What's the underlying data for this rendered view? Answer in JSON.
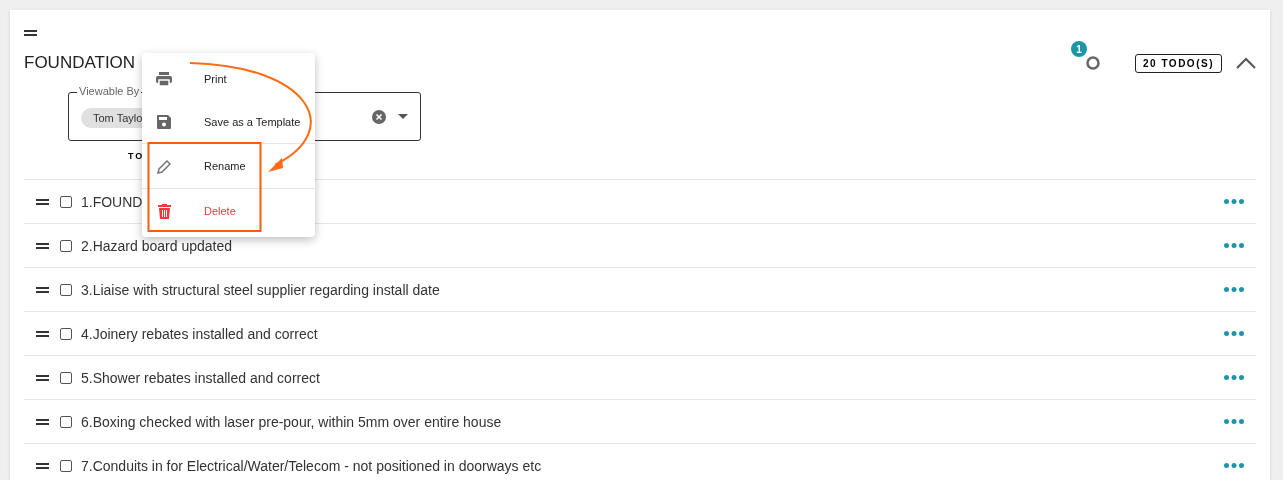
{
  "title": "FOUNDATION",
  "badge": "1",
  "todo_count": "20 TODO(S)",
  "expanded": true,
  "viewable_by": {
    "label": "Viewable By",
    "chips": [
      "Tom Taylo"
    ]
  },
  "column_header": "TO",
  "rows": [
    {
      "text": "1.FOUND",
      "checked": false
    },
    {
      "text": "2.Hazard board updated",
      "checked": false
    },
    {
      "text": "3.Liaise with structural steel supplier regarding install date",
      "checked": false
    },
    {
      "text": "4.Joinery rebates installed and correct",
      "checked": false
    },
    {
      "text": "5.Shower rebates installed and correct",
      "checked": false
    },
    {
      "text": "6.Boxing checked with laser pre-pour, within 5mm over entire house",
      "checked": false
    },
    {
      "text": "7.Conduits in for Electrical/Water/Telecom - not positioned in doorways etc",
      "checked": false
    }
  ],
  "menu": [
    {
      "label": "Print",
      "kind": "print",
      "highlighted": false
    },
    {
      "label": "Save as a Template",
      "kind": "save",
      "highlighted": false
    },
    {
      "label": "Rename",
      "kind": "rename",
      "highlighted": true
    },
    {
      "label": "Delete",
      "kind": "delete",
      "highlighted": true
    }
  ]
}
